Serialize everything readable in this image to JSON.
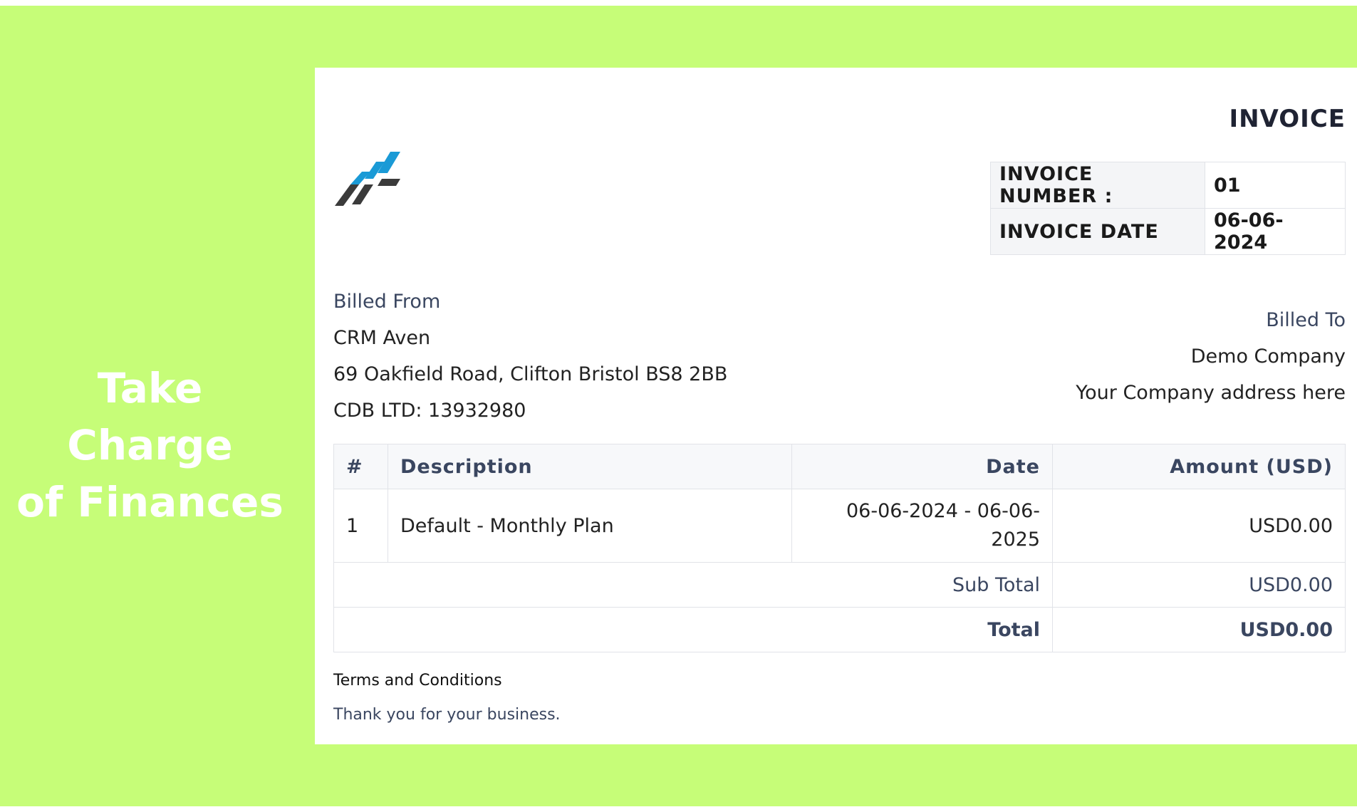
{
  "tagline": [
    "Take Charge",
    "of Finances"
  ],
  "invoice": {
    "title": "INVOICE",
    "number_label": "INVOICE NUMBER :",
    "number_value": "01",
    "date_label": "INVOICE DATE",
    "date_value": "06-06-2024"
  },
  "billed_from": {
    "heading": "Billed From",
    "name": "CRM Aven",
    "address": "69 Oakfield Road, Clifton Bristol BS8 2BB",
    "company_no": "CDB LTD: 13932980"
  },
  "billed_to": {
    "heading": "Billed To",
    "name": "Demo Company",
    "address": "Your Company address here"
  },
  "table": {
    "headers": [
      "#",
      "Description",
      "Date",
      "Amount (USD)"
    ],
    "rows": [
      {
        "num": "1",
        "description": "Default - Monthly Plan",
        "date_line1": "06-06-2024 - 06-06-",
        "date_line2": "2025",
        "amount": "USD0.00"
      }
    ],
    "subtotal_label": "Sub Total",
    "subtotal_value": "USD0.00",
    "total_label": "Total",
    "total_value": "USD0.00"
  },
  "terms": {
    "heading": "Terms and Conditions",
    "text": "Thank you for your business."
  },
  "colors": {
    "background": "#c6fd78",
    "logo_blue": "#1a9ad6",
    "logo_dark": "#3b3b3b"
  }
}
